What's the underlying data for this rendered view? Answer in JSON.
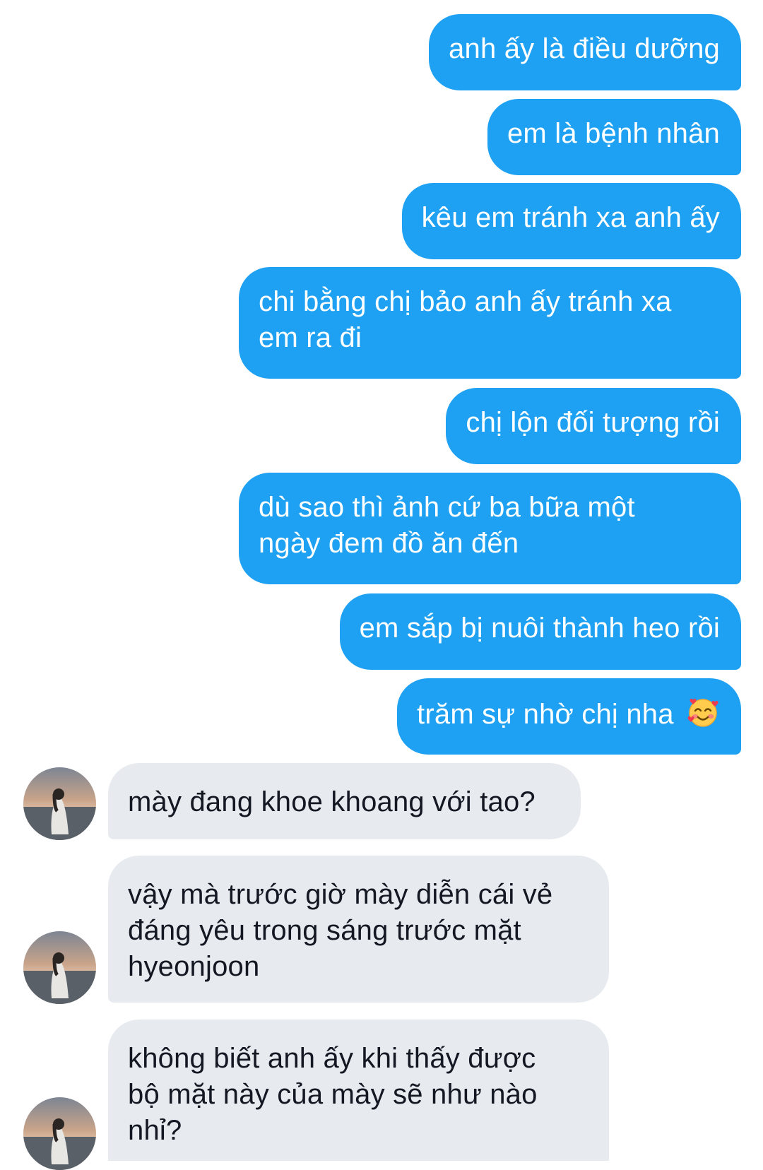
{
  "messages": [
    {
      "sender": "me",
      "text": "anh ấy là điều dưỡng"
    },
    {
      "sender": "me",
      "text": "em là bệnh nhân"
    },
    {
      "sender": "me",
      "text": "kêu em tránh xa anh ấy"
    },
    {
      "sender": "me",
      "lines": [
        "chi bằng chị bảo anh ấy tránh xa",
        "em ra đi"
      ]
    },
    {
      "sender": "me",
      "text": "chị lộn đối tượng rồi"
    },
    {
      "sender": "me",
      "lines": [
        "dù sao thì ảnh cứ ba bữa một",
        "ngày đem đồ ăn đến"
      ]
    },
    {
      "sender": "me",
      "text": "em sắp bị nuôi thành heo rồi"
    },
    {
      "sender": "me",
      "text": "trăm sự nhờ chị nha",
      "emoji": "smiling-face-with-hearts-icon"
    },
    {
      "sender": "them",
      "text": "mày đang khoe khoang với tao?"
    },
    {
      "sender": "them",
      "lines": [
        "vậy mà trước giờ mày diễn cái vẻ",
        "đáng yêu trong sáng trước mặt",
        "hyeonjoon"
      ]
    },
    {
      "sender": "them",
      "lines": [
        "không biết anh ấy khi thấy được",
        "bộ mặt này của mày sẽ như nào",
        "nhỉ?"
      ]
    }
  ],
  "colors": {
    "outgoing_bubble": "#1ea1f2",
    "outgoing_text": "#ffffff",
    "incoming_bubble": "#e7ebef",
    "incoming_text": "#141823"
  }
}
